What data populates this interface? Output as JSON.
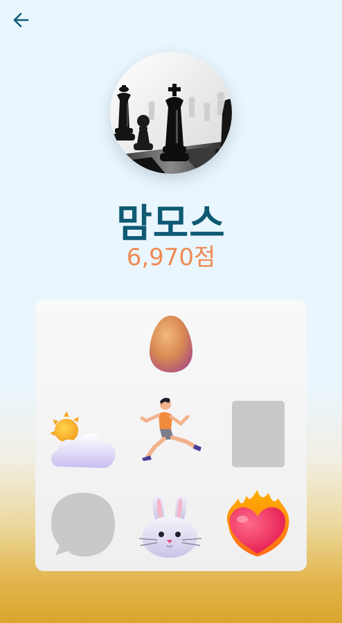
{
  "header": {
    "back_icon": "arrow-left-icon"
  },
  "profile": {
    "name": "맘모스",
    "score": "6,970점",
    "avatar_icon": "chess-pieces-photo"
  },
  "colors": {
    "name": "#0e5a73",
    "score": "#ef8a55",
    "icon": "#0e5a73"
  },
  "stickers": [
    {
      "row": 1,
      "col": 2,
      "icon": "egg-icon"
    },
    {
      "row": 2,
      "col": 1,
      "icon": "sun-behind-cloud-icon"
    },
    {
      "row": 2,
      "col": 2,
      "icon": "person-running-icon"
    },
    {
      "row": 2,
      "col": 3,
      "icon": "placeholder-rectangle"
    },
    {
      "row": 3,
      "col": 1,
      "icon": "speech-bubble-icon"
    },
    {
      "row": 3,
      "col": 2,
      "icon": "rabbit-face-icon"
    },
    {
      "row": 3,
      "col": 3,
      "icon": "heart-on-fire-icon"
    }
  ]
}
